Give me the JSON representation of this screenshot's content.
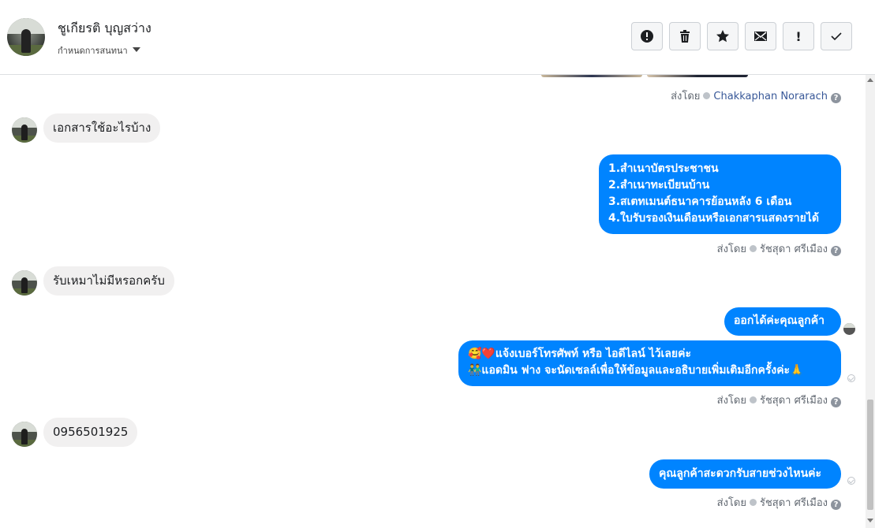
{
  "header": {
    "contact_name": "ชูเกียรติ บุญสว่าง",
    "assign_label": "กำหนดการสนทนา"
  },
  "toolbar": [
    {
      "name": "spam",
      "icon": "alert-circle-icon"
    },
    {
      "name": "delete",
      "icon": "trash-icon"
    },
    {
      "name": "star",
      "icon": "star-icon"
    },
    {
      "name": "mark-unread",
      "icon": "envelope-icon"
    },
    {
      "name": "follow-up",
      "icon": "exclamation-icon",
      "text": "!"
    },
    {
      "name": "done",
      "icon": "checkmark-icon"
    }
  ],
  "thread": {
    "top_meta": {
      "prefix": "ส่งโดย",
      "sender": "Chakkaphan Norarach"
    },
    "messages": [
      {
        "direction": "in",
        "text": "เอกสารใช้อะไรบ้าง"
      },
      {
        "direction": "out",
        "lines": [
          "1.สำเนาบัตรประชาชน",
          "2.สำเนาทะเบียนบ้าน",
          "3.สเตทเมนต์ธนาคารย้อนหลัง 6 เดือน",
          "4.ใบรับรองเงินเดือนหรือเอกสารแสดงรายได้"
        ]
      },
      {
        "direction": "meta",
        "prefix": "ส่งโดย",
        "sender": "รัชสุดา ศรีเมือง"
      },
      {
        "direction": "in",
        "text": "รับเหมาไม่มีหรอกครับ"
      },
      {
        "direction": "out",
        "lines": [
          "ออกได้ค่ะคุณลูกค้า"
        ]
      },
      {
        "direction": "out",
        "lines": [
          "🥰❤️แจ้งเบอร์โทรศัพท์ หรือ ไอดีไลน์  ไว้เลยค่ะ",
          "👬แอดมิน ฟาง จะนัดเซลล์เพื่อให้ข้อมูลและอธิบายเพิ่มเติมอีกครั้งค่ะ🙏"
        ]
      },
      {
        "direction": "meta",
        "prefix": "ส่งโดย",
        "sender": "รัชสุดา ศรีเมือง"
      },
      {
        "direction": "in",
        "text": "0956501925"
      },
      {
        "direction": "out",
        "lines": [
          "คุณลูกค้าสะดวกรับสายช่วงไหนค่ะ"
        ]
      },
      {
        "direction": "meta",
        "prefix": "ส่งโดย",
        "sender": "รัชสุดา ศรีเมือง"
      }
    ]
  },
  "colors": {
    "accent": "#0084ff",
    "incoming_bubble": "#f1f0f0",
    "link": "#385898"
  }
}
